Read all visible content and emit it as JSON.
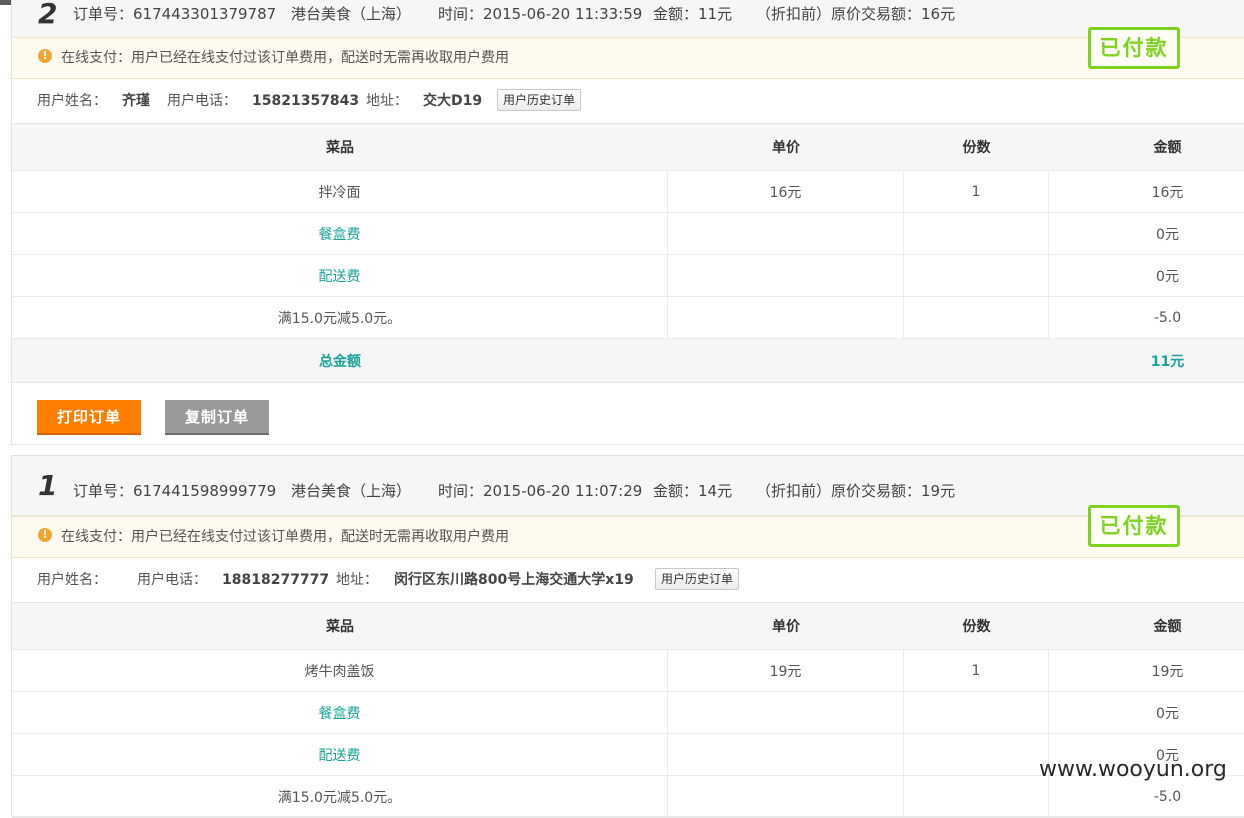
{
  "labels": {
    "order_no": "订单号：",
    "time": "时间：",
    "amount": "金额：",
    "original": "（折扣前）原价交易额：",
    "name": "用户姓名：",
    "phone": "用户电话：",
    "address": "地址：",
    "history_btn": "用户历史订单",
    "notice": "在线支付：用户已经在线支付过该订单费用，配送时无需再收取用户费用",
    "paid_stamp": "已付款",
    "warn_icon": "!"
  },
  "table_headers": {
    "dish": "菜品",
    "unit_price": "单价",
    "qty": "份数",
    "amount": "金额"
  },
  "orders": [
    {
      "num": "2",
      "order_no": "617443301379787",
      "shop": "港台美食（上海）",
      "time": "2015-06-20 11:33:59",
      "amount": "11元",
      "original": "16元",
      "customer_name": "齐瑾",
      "phone": "15821357843",
      "address": "交大D19",
      "items": [
        {
          "name": "拌冷面",
          "price": "16元",
          "qty": "1",
          "total": "16元"
        },
        {
          "name": "餐盒费",
          "price": "",
          "qty": "",
          "total": "0元"
        },
        {
          "name": "配送费",
          "price": "",
          "qty": "",
          "total": "0元"
        },
        {
          "name": "满15.0元减5.0元。",
          "price": "",
          "qty": "",
          "total": "-5.0"
        }
      ],
      "total_label": "总金额",
      "total": "11元",
      "print_btn": "打印订单",
      "copy_btn": "复制订单"
    },
    {
      "num": "1",
      "order_no": "617441598999779",
      "shop": "港台美食（上海）",
      "time": "2015-06-20 11:07:29",
      "amount": "14元",
      "original": "19元",
      "customer_name": "",
      "phone": "18818277777",
      "address": "闵行区东川路800号上海交通大学x19",
      "items": [
        {
          "name": "烤牛肉盖饭",
          "price": "19元",
          "qty": "1",
          "total": "19元"
        },
        {
          "name": "餐盒费",
          "price": "",
          "qty": "",
          "total": "0元"
        },
        {
          "name": "配送费",
          "price": "",
          "qty": "",
          "total": "0元"
        },
        {
          "name": "满15.0元减5.0元。",
          "price": "",
          "qty": "",
          "total": "-5.0"
        }
      ]
    }
  ],
  "watermark": "www.wooyun.org",
  "colors": {
    "accent_orange": "#ff7d00",
    "teal": "#1aa39a",
    "paid_green": "#7ed321",
    "copy_gray": "#9a9a9a"
  }
}
